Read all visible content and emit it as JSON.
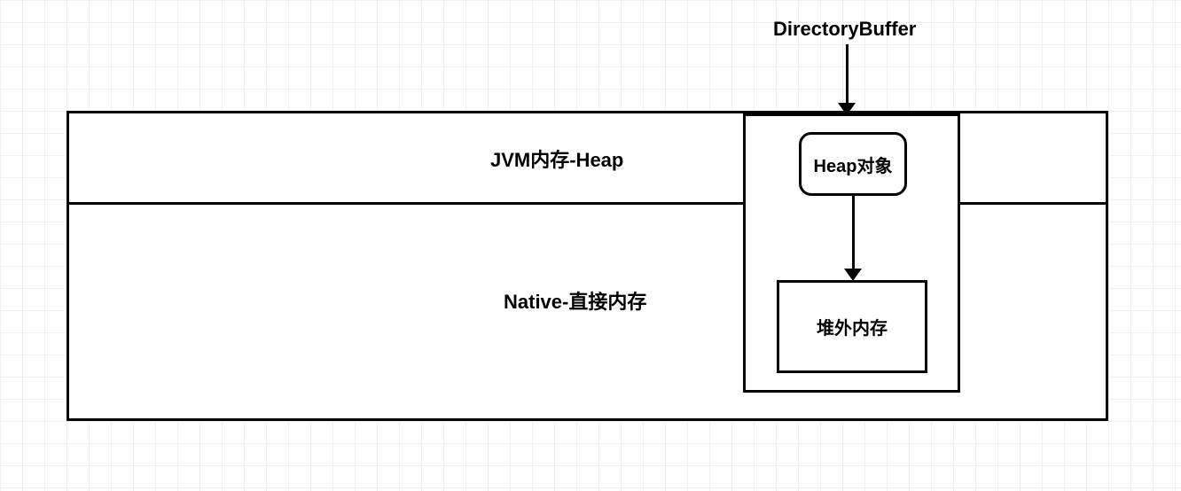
{
  "diagram": {
    "title": "DirectoryBuffer",
    "outer_box": {
      "top_section_label": "JVM内存-Heap",
      "bottom_section_label": "Native-直接内存"
    },
    "right_panel": {
      "heap_object_label": "Heap对象",
      "offheap_memory_label": "堆外内存"
    }
  }
}
